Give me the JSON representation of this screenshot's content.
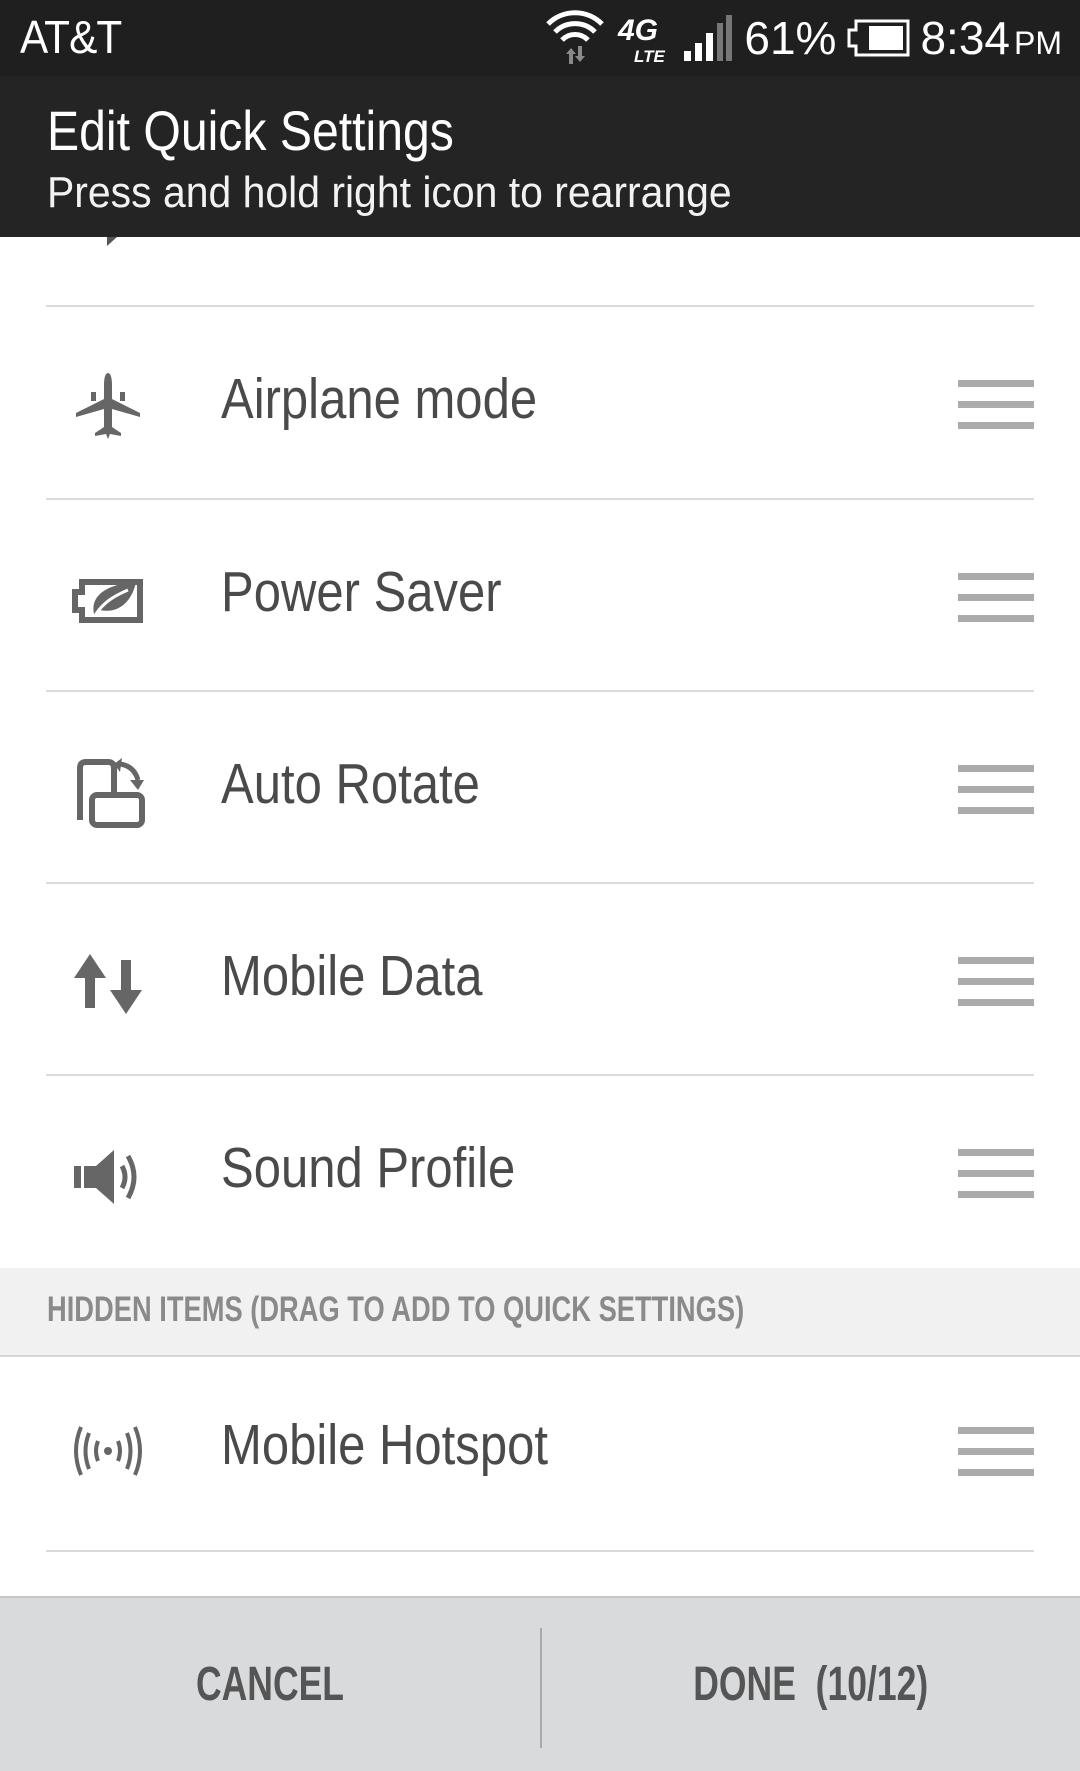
{
  "status_bar": {
    "carrier": "AT&T",
    "icons": [
      "wifi-icon",
      "data-activity-icon",
      "4g-lte-icon",
      "signal-icon",
      "battery-icon"
    ],
    "network_type": "4G",
    "network_sub": "LTE",
    "battery_percent": "61%",
    "time": "8:34",
    "ampm": "PM"
  },
  "header": {
    "title": "Edit Quick Settings",
    "subtitle": "Press and hold right icon to rearrange"
  },
  "quick_settings": {
    "items": [
      {
        "label": "Airplane mode",
        "icon": "airplane-icon"
      },
      {
        "label": "Power Saver",
        "icon": "power-saver-icon"
      },
      {
        "label": "Auto Rotate",
        "icon": "auto-rotate-icon"
      },
      {
        "label": "Mobile Data",
        "icon": "mobile-data-icon"
      },
      {
        "label": "Sound Profile",
        "icon": "speaker-icon"
      }
    ]
  },
  "hidden_section": {
    "label": "HIDDEN ITEMS (DRAG TO ADD TO QUICK SETTINGS)",
    "items": [
      {
        "label": "Mobile Hotspot",
        "icon": "hotspot-icon"
      }
    ]
  },
  "footer": {
    "cancel_label": "CANCEL",
    "done_label": "DONE  (10/12)"
  },
  "colors": {
    "header_bg": "#242424",
    "text": "#4a4a4a",
    "section_bg": "#f1f1f1",
    "footer_bg": "#d9dadc"
  }
}
